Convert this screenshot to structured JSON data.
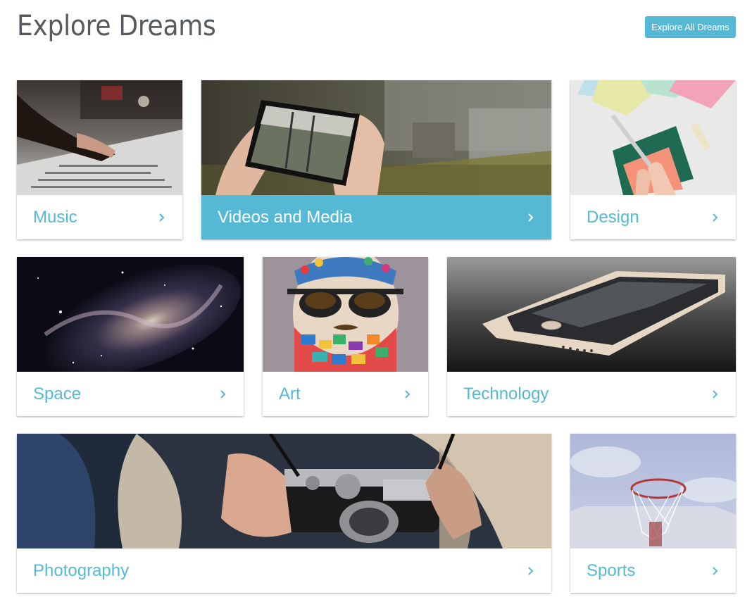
{
  "header": {
    "title": "Explore Dreams",
    "explore_all_label": "Explore All Dreams"
  },
  "colors": {
    "accent": "#55b9d6",
    "title": "#555a5e",
    "background": "#ffffff"
  },
  "categories": [
    {
      "label": "Music",
      "image": "mixing-console-photo",
      "selected": false
    },
    {
      "label": "Videos and Media",
      "image": "phone-video-photo",
      "selected": true
    },
    {
      "label": "Design",
      "image": "paper-cutting-photo",
      "selected": false
    },
    {
      "label": "Space",
      "image": "galaxy-photo",
      "selected": false
    },
    {
      "label": "Art",
      "image": "bearded-man-painting",
      "selected": false
    },
    {
      "label": "Technology",
      "image": "smartphone-photo",
      "selected": false
    },
    {
      "label": "Photography",
      "image": "camera-hands-photo",
      "selected": false
    },
    {
      "label": "Sports",
      "image": "basketball-hoop-photo",
      "selected": false
    }
  ],
  "icons": {
    "arrow": "chevron-right-icon"
  }
}
